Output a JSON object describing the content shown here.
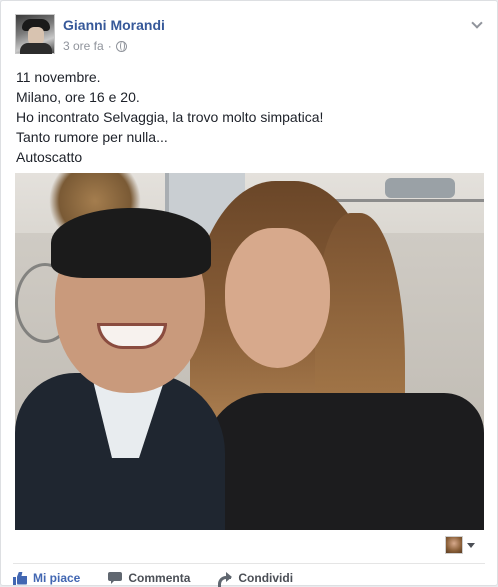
{
  "post": {
    "author": "Gianni Morandi",
    "time": "3 ore fa",
    "separator": "·",
    "lines": [
      "11 novembre.",
      "Milano, ore 16 e 20.",
      "Ho incontrato Selvaggia, la trovo molto simpatica!",
      "Tanto rumore per nulla...",
      "Autoscatto"
    ]
  },
  "actions": {
    "like": "Mi piace",
    "comment": "Commenta",
    "share": "Condividi"
  },
  "colors": {
    "author": "#365899",
    "like": "#4267b2",
    "meta": "#90949c"
  },
  "icons": [
    "globe-icon",
    "chevron-down-icon",
    "like-icon",
    "comment-icon",
    "share-icon",
    "caret-down-icon"
  ]
}
